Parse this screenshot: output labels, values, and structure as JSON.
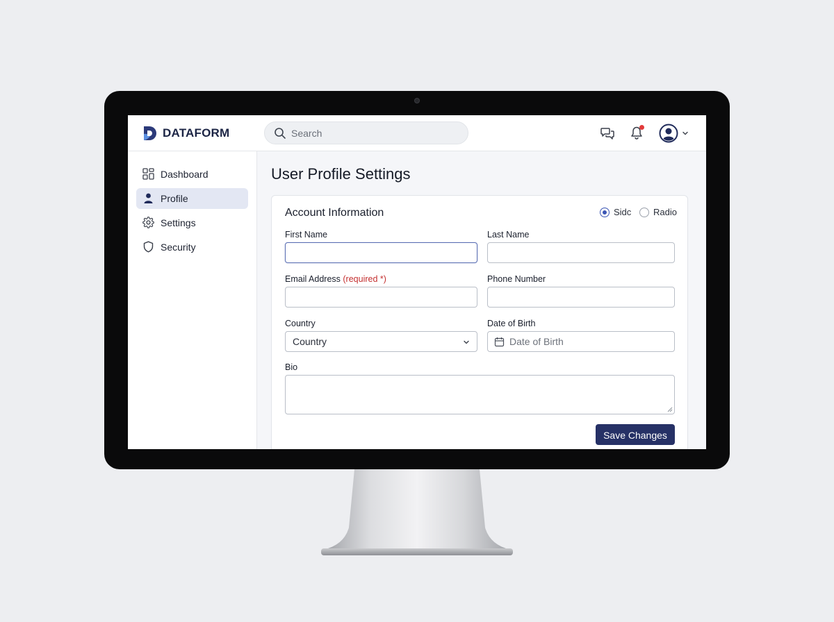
{
  "app": {
    "name": "DATAFORM",
    "brand_color": "#263166"
  },
  "topbar": {
    "search_placeholder": "Search",
    "icons": [
      "messages-icon",
      "bell-icon",
      "user-avatar-icon",
      "chevron-down-icon"
    ],
    "notification_dot_color": "#e23a3a"
  },
  "sidebar": {
    "items": [
      {
        "label": "Dashboard",
        "icon": "dashboard-grid-icon",
        "active": false
      },
      {
        "label": "Profile",
        "icon": "person-icon",
        "active": true
      },
      {
        "label": "Settings",
        "icon": "gear-icon",
        "active": false
      },
      {
        "label": "Security",
        "icon": "shield-icon",
        "active": false
      }
    ]
  },
  "main": {
    "page_title": "User Profile Settings",
    "card": {
      "title": "Account Information",
      "radios": [
        {
          "label": "Sidc",
          "checked": true
        },
        {
          "label": "Radio",
          "checked": false
        }
      ],
      "fields": {
        "first_name": {
          "label": "First Name",
          "value": "",
          "placeholder": ""
        },
        "last_name": {
          "label": "Last Name",
          "value": "",
          "placeholder": ""
        },
        "email": {
          "label": "Email Address",
          "required_note": "(required *)",
          "value": "",
          "placeholder": ""
        },
        "phone": {
          "label": "Phone Number",
          "value": "",
          "placeholder": ""
        },
        "country": {
          "label": "Country",
          "selected": "Country"
        },
        "dob": {
          "label": "Date of Birth",
          "value": "",
          "placeholder": "Date of Birth"
        },
        "bio": {
          "label": "Bio",
          "value": "",
          "placeholder": ""
        }
      },
      "save_label": "Save Changes"
    }
  }
}
